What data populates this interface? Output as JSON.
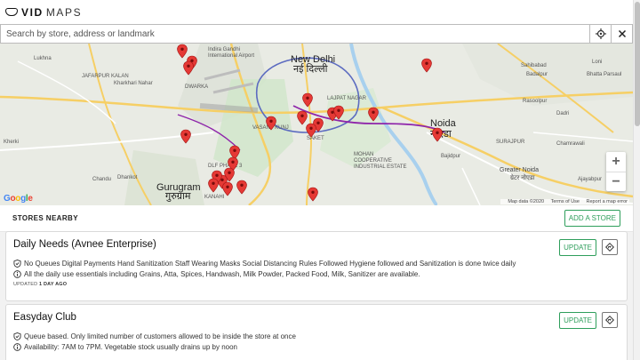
{
  "app": {
    "logo_prefix": "C",
    "logo_mid": "VID",
    "logo_suffix": "MAPS"
  },
  "search": {
    "placeholder": "Search by store, address or landmark",
    "locate_icon": "crosshair-icon",
    "close_icon": "close-icon"
  },
  "map": {
    "labels": {
      "new_delhi": "New Delhi",
      "new_delhi_hi": "नई दिल्ली",
      "gurugram": "Gurugram",
      "gurugram_hi": "गुरुग्राम",
      "noida": "Noida",
      "noida_hi": "नोएडा",
      "greater_noida": "Greater Noida",
      "greater_noida_hi": "ग्रेटर नोएडा",
      "airport": "Indira Gandhi International Airport",
      "lajpat": "LAJPAT NAGAR",
      "vasant_kunj": "VASANT KUNJ",
      "saket": "SAKET",
      "dwarka": "DWARKA",
      "mohan": "MOHAN COOPERATIVE INDUSTRIAL ESTATE",
      "surajpur": "SURAJPUR",
      "dlf": "DLF PHASE 3",
      "kanahi": "KANAHI",
      "ghaziabad": "Sahibabad",
      "loni": "Loni",
      "lukhna": "Lukhna",
      "bhatta": "Bhatta Parsaul",
      "badalpur": "Badalpur",
      "rasoolpur": "Rasoolpur",
      "jafarpur": "JAFARPUR KALAN",
      "kharkhari": "Kharkhari Nahar",
      "kherki": "Kherki",
      "dhankot": "Dhankot",
      "chandu": "Chandu",
      "bajidpur": "Bajidpur",
      "dadri": "Dadri",
      "chamrawali": "Chamrawali",
      "ajayabpur": "Ajayabpur"
    },
    "google_logo": "Google",
    "attribution": "Map data ©2020",
    "terms": "Terms of Use",
    "report": "Report a map error",
    "zoom_in": "+",
    "zoom_out": "−"
  },
  "stores": {
    "heading": "STORES NEARBY",
    "add_button": "ADD A STORE",
    "update_label": "UPDATE",
    "items": [
      {
        "name": "Daily Needs (Avnee Enterprise)",
        "safety": "No Queues Digital Payments Hand Sanitization Staff Wearing Masks Social Distancing Rules Followed Hygiene followed and Sanitization is done twice daily",
        "info": "All the daily use essentials including Grains, Atta, Spices, Handwash, Milk Powder, Packed Food, Milk, Sanitizer are available.",
        "updated_label": "UPDATED",
        "updated_ago": "1 DAY AGO"
      },
      {
        "name": "Easyday Club",
        "safety": "Queue based. Only limited number of customers allowed to be inside the store at once",
        "info": "Availability: 7AM to 7PM. Vegetable stock usually drains up by noon"
      }
    ]
  },
  "colors": {
    "accent": "#2e9e5b",
    "pin": "#e53935",
    "metro": "#8e24aa"
  }
}
